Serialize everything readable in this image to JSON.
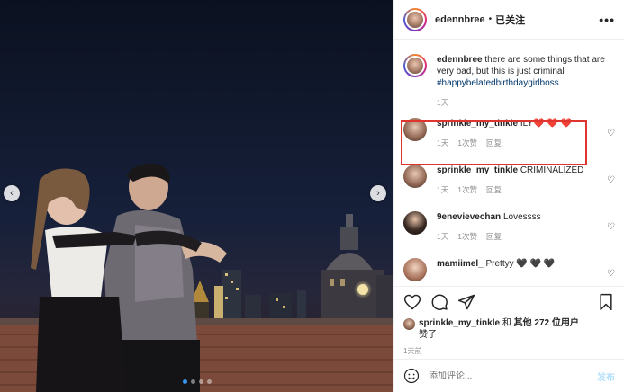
{
  "header": {
    "username": "edennbree",
    "separator": "•",
    "follow_state": "已关注",
    "more": "•••"
  },
  "caption": {
    "username": "edennbree",
    "text": "there are some things that are very bad, but this is just criminal",
    "hashtag": "#happybelatedbirthdaygirlboss",
    "time": "1天"
  },
  "comments": [
    {
      "username": "sprinkle_my_tinkle",
      "text": "ILY❤️ ❤️ ❤️",
      "time": "1天",
      "likes": "1次赞",
      "reply": "回复",
      "highlighted": true
    },
    {
      "username": "sprinkle_my_tinkle",
      "text": "CRIMINALIZED",
      "time": "1天",
      "likes": "1次赞",
      "reply": "回复"
    },
    {
      "username": "9enevievechan",
      "text": "Lovessss",
      "time": "1天",
      "likes": "1次赞",
      "reply": "回复"
    },
    {
      "username": "mamiimel_",
      "text": "Prettyy 🖤 🖤 🖤",
      "time": "",
      "likes": "",
      "reply": ""
    }
  ],
  "likes": {
    "username": "sprinkle_my_tinkle",
    "connector": " 和 ",
    "others": "其他 272 位用户",
    "suffix": "赞了"
  },
  "post_time": "1天前",
  "add_comment": {
    "placeholder": "添加评论...",
    "post_label": "发布"
  },
  "carousel": {
    "prev": "‹",
    "next": "›",
    "slides": 4,
    "active": 0
  },
  "colors": {
    "highlight": "#e0342e",
    "hashtag": "#00376b",
    "muted": "#8e8e8e",
    "post_disabled": "#b2dffc"
  }
}
